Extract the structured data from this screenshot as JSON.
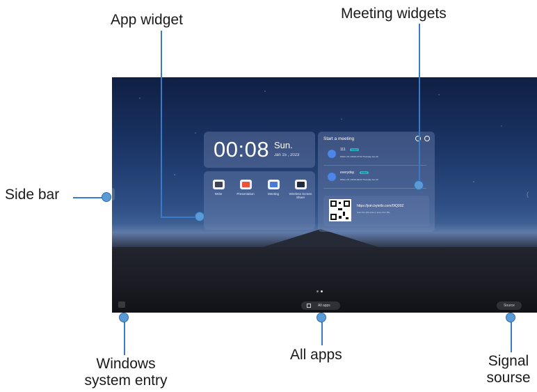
{
  "callouts": {
    "app_widget": "App widget",
    "meeting_widgets": "Meeting widgets",
    "side_bar": "Side bar",
    "windows_entry_line1": "Windows",
    "windows_entry_line2": "system entry",
    "all_apps": "All apps",
    "signal_line1": "Signal",
    "signal_line2": "sourse"
  },
  "clock": {
    "time": "00:08",
    "day": "Sun.",
    "date": "Jan 15 , 2023"
  },
  "apps": [
    {
      "label": "Write",
      "icon": "whiteboard-icon",
      "color": "#3c4454"
    },
    {
      "label": "Presentation",
      "icon": "presentation-icon",
      "color": "#e9533b"
    },
    {
      "label": "Meeting",
      "icon": "meeting-icon",
      "color": "#4a79d8"
    },
    {
      "label": "Wireless Screen Share",
      "icon": "wireless-share-icon",
      "color": "#1f2a3a"
    }
  ],
  "meeting": {
    "title": "Start a meeting",
    "items": [
      {
        "name": "111",
        "tag": "Invited",
        "meta": "DING LIN | 08:00-07:00 Thursday Jan 19"
      },
      {
        "name": "everyday",
        "tag": "Invited",
        "meta": "DING LIN | 08:00-09:00 Thursday Jan 19"
      }
    ],
    "join_url": "https://join.bytello.com/0IQ00Z",
    "join_hint": "Scan the QR code or enter the URL"
  },
  "taskbar": {
    "all_apps": "All apps",
    "source": "Source"
  },
  "colors": {
    "accent": "#5b9bd5",
    "leader": "#3a7bc8",
    "avatar": "#4d86e8",
    "tag": "#2fb6c8"
  }
}
